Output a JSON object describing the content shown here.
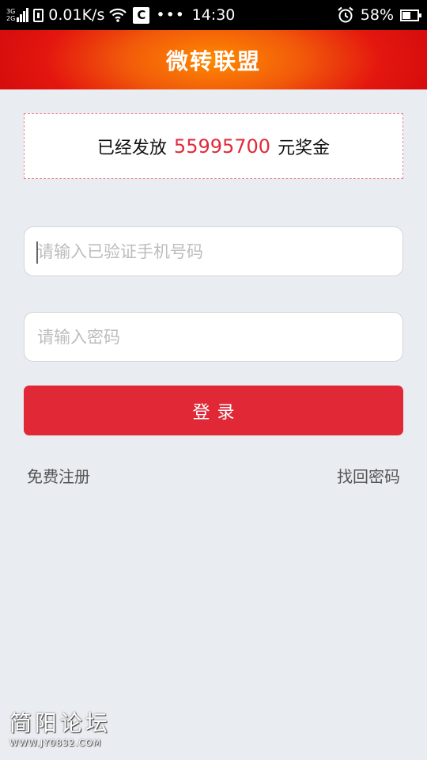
{
  "status_bar": {
    "network_top": "3G",
    "network_bottom": "2G",
    "speed": "0.01K/s",
    "app_icon_letter": "C",
    "more": "•••",
    "time": "14:30",
    "battery_percent": "58%",
    "battery_level": 0.58
  },
  "header": {
    "title": "微转联盟"
  },
  "bonus": {
    "prefix": "已经发放",
    "amount": "55995700",
    "suffix": "元奖金",
    "amount_color": "#e02a3a"
  },
  "form": {
    "phone_placeholder": "请输入已验证手机号码",
    "password_placeholder": "请输入密码",
    "login_label": "登录"
  },
  "links": {
    "register": "免费注册",
    "forgot_password": "找回密码"
  },
  "watermark": {
    "title": "简阳论坛",
    "url": "WWW.JY0832.COM"
  },
  "colors": {
    "primary": "#e12836",
    "header_center": "#ff8a00",
    "header_edge": "#d60d0d",
    "background": "#e9ecf0"
  }
}
